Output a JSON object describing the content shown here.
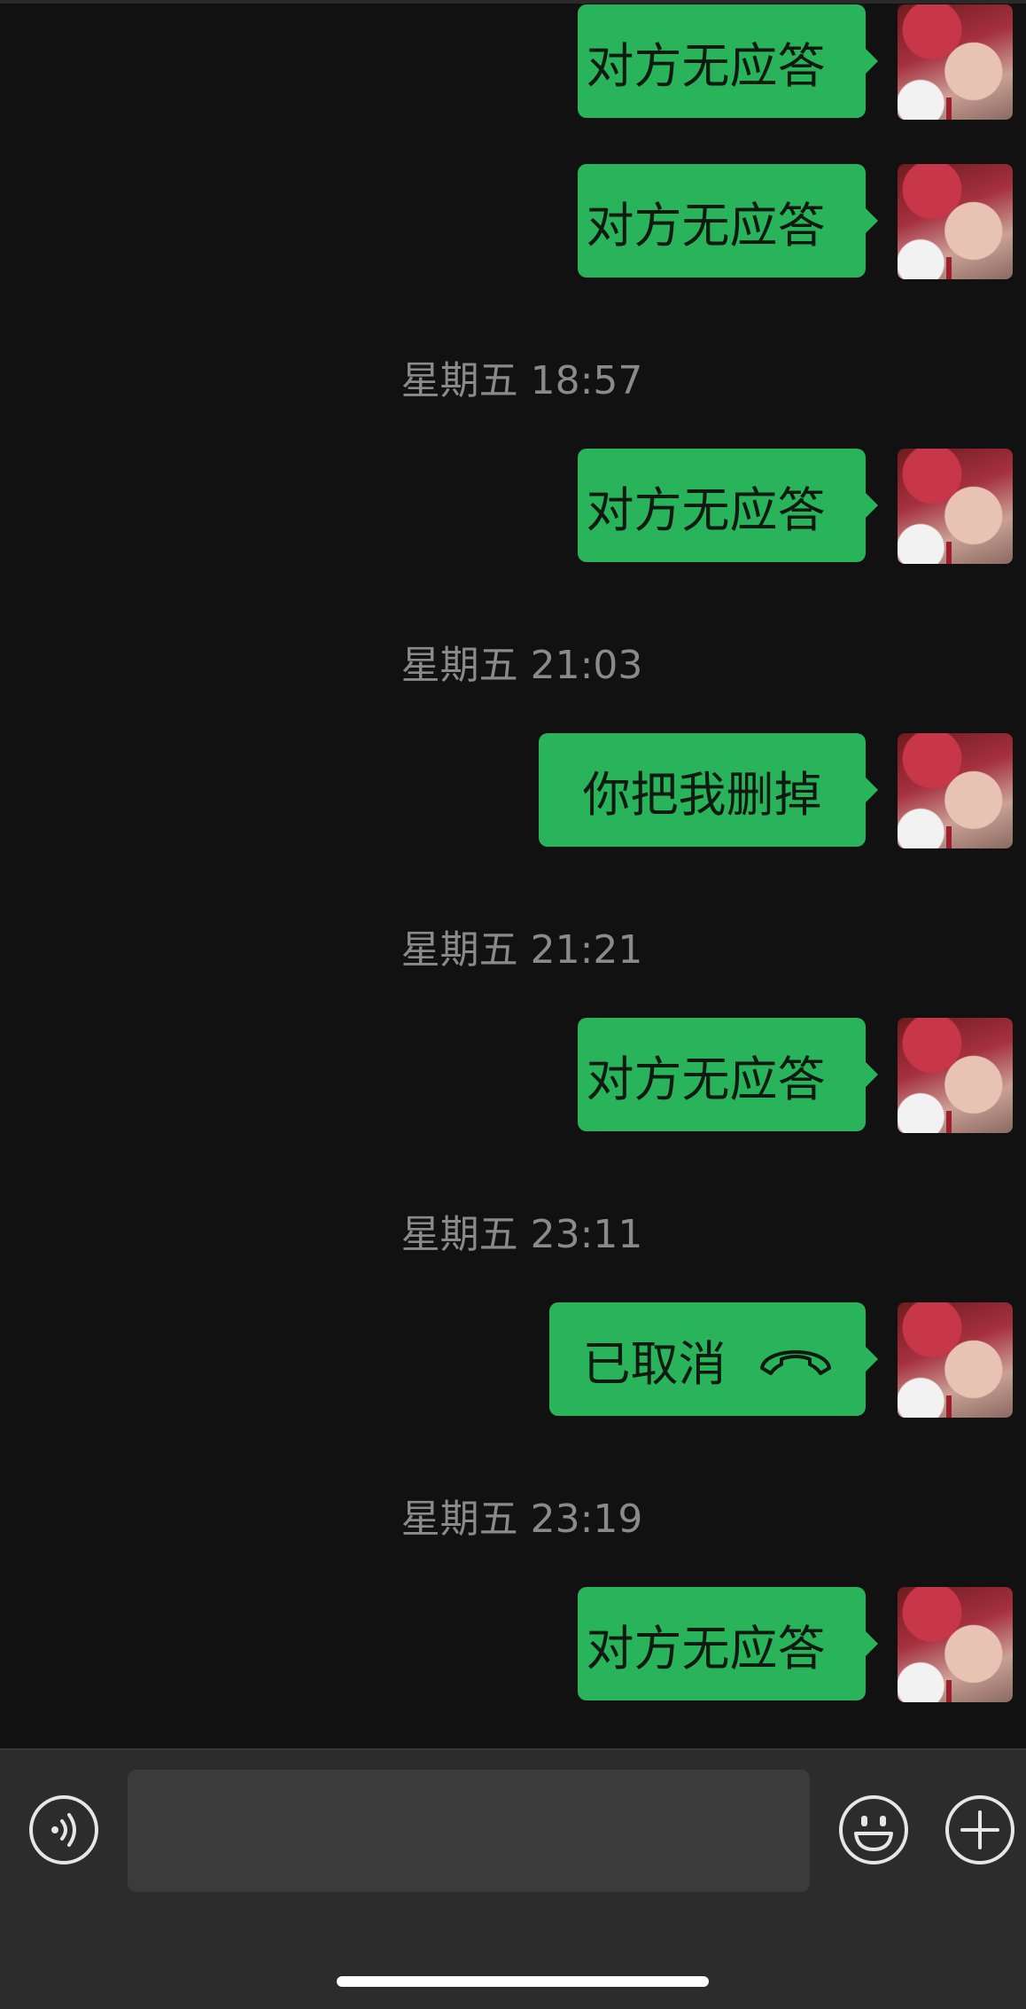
{
  "messages": [
    {
      "text": "对方无应答",
      "phone_icon": true
    },
    {
      "text": "对方无应答",
      "phone_icon": true
    },
    {
      "text": "对方无应答",
      "phone_icon": true
    },
    {
      "text": "你把我删掉",
      "phone_icon": false
    },
    {
      "text": "对方无应答",
      "phone_icon": true
    },
    {
      "text": "已取消",
      "phone_icon": true
    },
    {
      "text": "对方无应答",
      "phone_icon": true
    }
  ],
  "timestamps": [
    "星期五 18:57",
    "星期五 21:03",
    "星期五 21:21",
    "星期五 23:11",
    "星期五 23:19"
  ],
  "input": {
    "value": ""
  },
  "icons": {
    "voice": "voice-icon",
    "emoji": "emoji-icon",
    "plus": "plus-icon",
    "phone": "phone-icon"
  },
  "colors": {
    "background": "#111111",
    "bubble": "#29b35a",
    "timestamp": "#8a8a8a",
    "input_bar": "#2c2c2c"
  }
}
